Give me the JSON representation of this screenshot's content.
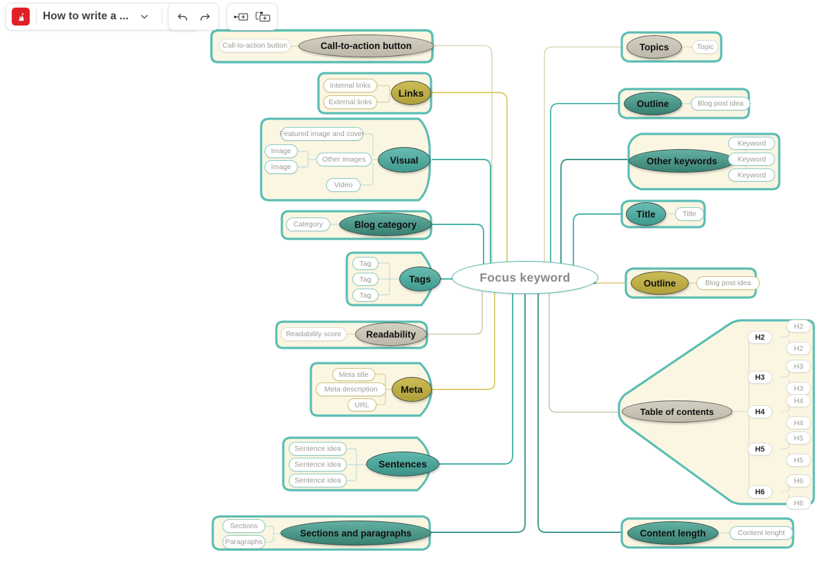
{
  "toolbar": {
    "logo_icon": "mindmap-logo-icon",
    "doc_title": "How to write a ...",
    "chevron_icon": "chevron-down-icon",
    "menu_icon": "hamburger-menu-icon",
    "undo_icon": "undo-arrow-icon",
    "redo_icon": "redo-arrow-icon",
    "add_sibling_icon": "add-sibling-node-icon",
    "add_child_icon": "add-child-node-icon"
  },
  "colors": {
    "accent_teal": "#49b3a8",
    "panel_fill": "#faf6e2",
    "panel_stroke": "#5bbdb4",
    "gold": "#b0a03a",
    "grey_node": "#bdb8a8",
    "logo_red": "#e01f26"
  },
  "mindmap": {
    "center": {
      "label": "Focus keyword"
    },
    "left_branches": [
      {
        "id": "cta",
        "label": "Call-to-action button",
        "style": "grey",
        "children": [
          {
            "label": "Call-to-action button"
          }
        ]
      },
      {
        "id": "links",
        "label": "Links",
        "style": "gold",
        "children": [
          {
            "label": "Internal links"
          },
          {
            "label": "External links"
          }
        ]
      },
      {
        "id": "visual",
        "label": "Visual",
        "style": "teal",
        "children": [
          {
            "label": "Featured image and cover"
          },
          {
            "label": "Other images",
            "children": [
              {
                "label": "Image"
              },
              {
                "label": "Image"
              }
            ]
          },
          {
            "label": "Video"
          }
        ]
      },
      {
        "id": "blogcat",
        "label": "Blog category",
        "style": "dteal",
        "children": [
          {
            "label": "Category"
          }
        ]
      },
      {
        "id": "tags",
        "label": "Tags",
        "style": "teal",
        "children": [
          {
            "label": "Tag"
          },
          {
            "label": "Tag"
          },
          {
            "label": "Tag"
          }
        ]
      },
      {
        "id": "readability",
        "label": "Readability",
        "style": "grey",
        "children": [
          {
            "label": "Readability score"
          }
        ]
      },
      {
        "id": "meta",
        "label": "Meta",
        "style": "gold",
        "children": [
          {
            "label": "Meta title"
          },
          {
            "label": "Meta description"
          },
          {
            "label": "URL"
          }
        ]
      },
      {
        "id": "sentences",
        "label": "Sentences",
        "style": "teal2",
        "children": [
          {
            "label": "Sentence idea"
          },
          {
            "label": "Sentence idea"
          },
          {
            "label": "Sentence idea"
          }
        ]
      },
      {
        "id": "sections",
        "label": "Sections and paragraphs",
        "style": "dteal",
        "children": [
          {
            "label": "Sections"
          },
          {
            "label": "Paragraphs"
          }
        ]
      }
    ],
    "right_branches": [
      {
        "id": "topics",
        "label": "Topics",
        "style": "grey",
        "children": [
          {
            "label": "Topic"
          }
        ]
      },
      {
        "id": "outline1",
        "label": "Outline",
        "style": "dteal",
        "children": [
          {
            "label": "Blog post idea"
          }
        ]
      },
      {
        "id": "otherkw",
        "label": "Other keywords",
        "style": "dteal",
        "children": [
          {
            "label": "Keyword"
          },
          {
            "label": "Keyword"
          },
          {
            "label": "Keyword"
          }
        ]
      },
      {
        "id": "title",
        "label": "Title",
        "style": "teal",
        "children": [
          {
            "label": "Title"
          }
        ]
      },
      {
        "id": "outline2",
        "label": "Outline",
        "style": "gold",
        "children": [
          {
            "label": "Blog post idea"
          }
        ]
      },
      {
        "id": "toc",
        "label": "Table of contents",
        "style": "grey",
        "children": [
          {
            "label": "H2",
            "children": [
              {
                "label": "H2"
              },
              {
                "label": "H2"
              }
            ]
          },
          {
            "label": "H3",
            "children": [
              {
                "label": "H3"
              },
              {
                "label": "H3"
              }
            ]
          },
          {
            "label": "H4",
            "children": [
              {
                "label": "H4"
              },
              {
                "label": "H4"
              }
            ]
          },
          {
            "label": "H5",
            "children": [
              {
                "label": "H5"
              },
              {
                "label": "H5"
              }
            ]
          },
          {
            "label": "H6",
            "children": [
              {
                "label": "H6"
              },
              {
                "label": "H6"
              }
            ]
          }
        ]
      },
      {
        "id": "contentlen",
        "label": "Content length",
        "style": "dteal",
        "children": [
          {
            "label": "Content lenght"
          }
        ]
      }
    ]
  }
}
